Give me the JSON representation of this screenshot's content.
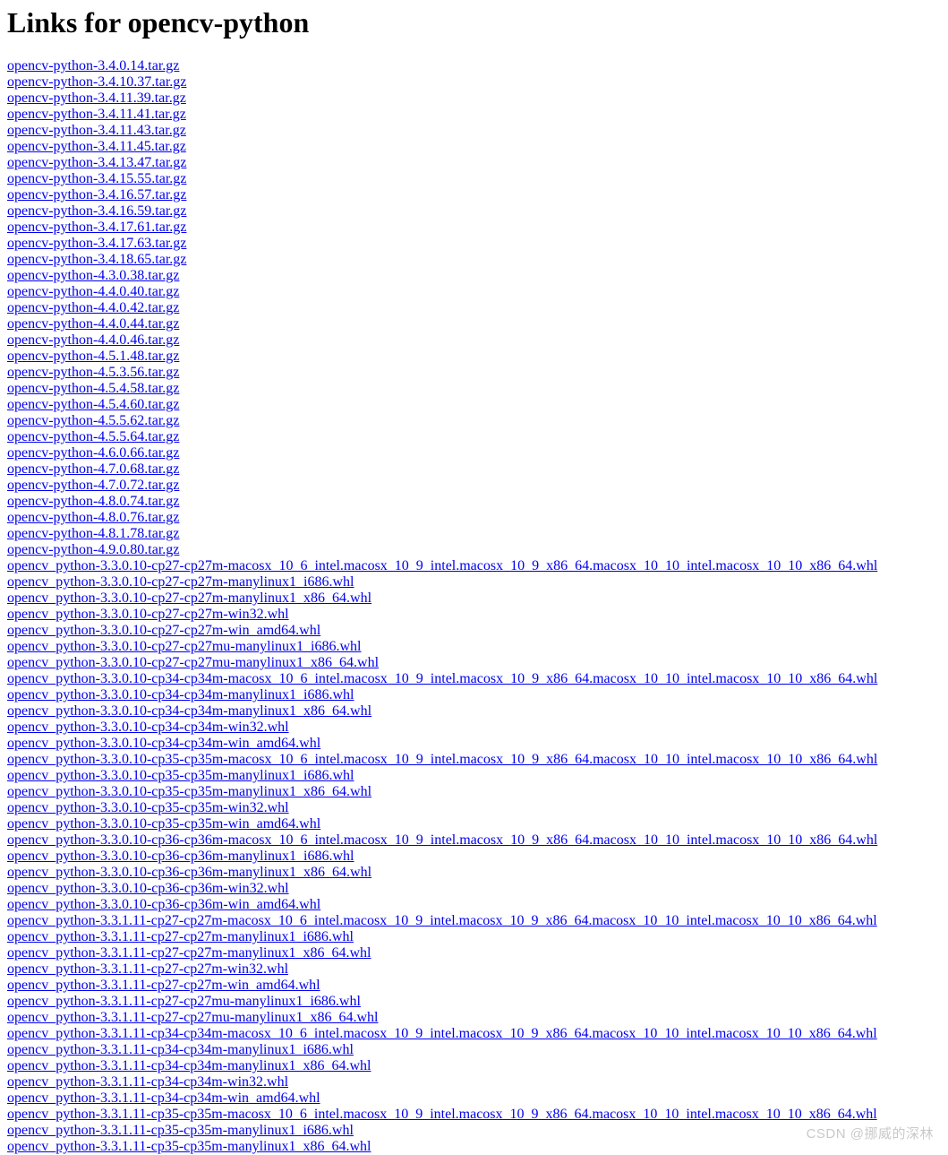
{
  "page": {
    "title": "Links for opencv-python",
    "link_color": "#0000ee",
    "background_color": "#ffffff",
    "text_color": "#000000"
  },
  "watermark": {
    "text": "CSDN @挪威的深林",
    "color": "#c9c9c9"
  },
  "links": [
    {
      "label": "opencv-python-3.4.0.14.tar.gz"
    },
    {
      "label": "opencv-python-3.4.10.37.tar.gz"
    },
    {
      "label": "opencv-python-3.4.11.39.tar.gz"
    },
    {
      "label": "opencv-python-3.4.11.41.tar.gz"
    },
    {
      "label": "opencv-python-3.4.11.43.tar.gz"
    },
    {
      "label": "opencv-python-3.4.11.45.tar.gz"
    },
    {
      "label": "opencv-python-3.4.13.47.tar.gz"
    },
    {
      "label": "opencv-python-3.4.15.55.tar.gz"
    },
    {
      "label": "opencv-python-3.4.16.57.tar.gz"
    },
    {
      "label": "opencv-python-3.4.16.59.tar.gz"
    },
    {
      "label": "opencv-python-3.4.17.61.tar.gz"
    },
    {
      "label": "opencv-python-3.4.17.63.tar.gz"
    },
    {
      "label": "opencv-python-3.4.18.65.tar.gz"
    },
    {
      "label": "opencv-python-4.3.0.38.tar.gz"
    },
    {
      "label": "opencv-python-4.4.0.40.tar.gz"
    },
    {
      "label": "opencv-python-4.4.0.42.tar.gz"
    },
    {
      "label": "opencv-python-4.4.0.44.tar.gz"
    },
    {
      "label": "opencv-python-4.4.0.46.tar.gz"
    },
    {
      "label": "opencv-python-4.5.1.48.tar.gz"
    },
    {
      "label": "opencv-python-4.5.3.56.tar.gz"
    },
    {
      "label": "opencv-python-4.5.4.58.tar.gz"
    },
    {
      "label": "opencv-python-4.5.4.60.tar.gz"
    },
    {
      "label": "opencv-python-4.5.5.62.tar.gz"
    },
    {
      "label": "opencv-python-4.5.5.64.tar.gz"
    },
    {
      "label": "opencv-python-4.6.0.66.tar.gz"
    },
    {
      "label": "opencv-python-4.7.0.68.tar.gz"
    },
    {
      "label": "opencv-python-4.7.0.72.tar.gz"
    },
    {
      "label": "opencv-python-4.8.0.74.tar.gz"
    },
    {
      "label": "opencv-python-4.8.0.76.tar.gz"
    },
    {
      "label": "opencv-python-4.8.1.78.tar.gz"
    },
    {
      "label": "opencv-python-4.9.0.80.tar.gz"
    },
    {
      "label": "opencv_python-3.3.0.10-cp27-cp27m-macosx_10_6_intel.macosx_10_9_intel.macosx_10_9_x86_64.macosx_10_10_intel.macosx_10_10_x86_64.whl"
    },
    {
      "label": "opencv_python-3.3.0.10-cp27-cp27m-manylinux1_i686.whl"
    },
    {
      "label": "opencv_python-3.3.0.10-cp27-cp27m-manylinux1_x86_64.whl"
    },
    {
      "label": "opencv_python-3.3.0.10-cp27-cp27m-win32.whl"
    },
    {
      "label": "opencv_python-3.3.0.10-cp27-cp27m-win_amd64.whl"
    },
    {
      "label": "opencv_python-3.3.0.10-cp27-cp27mu-manylinux1_i686.whl"
    },
    {
      "label": "opencv_python-3.3.0.10-cp27-cp27mu-manylinux1_x86_64.whl"
    },
    {
      "label": "opencv_python-3.3.0.10-cp34-cp34m-macosx_10_6_intel.macosx_10_9_intel.macosx_10_9_x86_64.macosx_10_10_intel.macosx_10_10_x86_64.whl"
    },
    {
      "label": "opencv_python-3.3.0.10-cp34-cp34m-manylinux1_i686.whl"
    },
    {
      "label": "opencv_python-3.3.0.10-cp34-cp34m-manylinux1_x86_64.whl"
    },
    {
      "label": "opencv_python-3.3.0.10-cp34-cp34m-win32.whl"
    },
    {
      "label": "opencv_python-3.3.0.10-cp34-cp34m-win_amd64.whl"
    },
    {
      "label": "opencv_python-3.3.0.10-cp35-cp35m-macosx_10_6_intel.macosx_10_9_intel.macosx_10_9_x86_64.macosx_10_10_intel.macosx_10_10_x86_64.whl"
    },
    {
      "label": "opencv_python-3.3.0.10-cp35-cp35m-manylinux1_i686.whl"
    },
    {
      "label": "opencv_python-3.3.0.10-cp35-cp35m-manylinux1_x86_64.whl"
    },
    {
      "label": "opencv_python-3.3.0.10-cp35-cp35m-win32.whl"
    },
    {
      "label": "opencv_python-3.3.0.10-cp35-cp35m-win_amd64.whl"
    },
    {
      "label": "opencv_python-3.3.0.10-cp36-cp36m-macosx_10_6_intel.macosx_10_9_intel.macosx_10_9_x86_64.macosx_10_10_intel.macosx_10_10_x86_64.whl"
    },
    {
      "label": "opencv_python-3.3.0.10-cp36-cp36m-manylinux1_i686.whl"
    },
    {
      "label": "opencv_python-3.3.0.10-cp36-cp36m-manylinux1_x86_64.whl"
    },
    {
      "label": "opencv_python-3.3.0.10-cp36-cp36m-win32.whl"
    },
    {
      "label": "opencv_python-3.3.0.10-cp36-cp36m-win_amd64.whl"
    },
    {
      "label": "opencv_python-3.3.1.11-cp27-cp27m-macosx_10_6_intel.macosx_10_9_intel.macosx_10_9_x86_64.macosx_10_10_intel.macosx_10_10_x86_64.whl"
    },
    {
      "label": "opencv_python-3.3.1.11-cp27-cp27m-manylinux1_i686.whl"
    },
    {
      "label": "opencv_python-3.3.1.11-cp27-cp27m-manylinux1_x86_64.whl"
    },
    {
      "label": "opencv_python-3.3.1.11-cp27-cp27m-win32.whl"
    },
    {
      "label": "opencv_python-3.3.1.11-cp27-cp27m-win_amd64.whl"
    },
    {
      "label": "opencv_python-3.3.1.11-cp27-cp27mu-manylinux1_i686.whl"
    },
    {
      "label": "opencv_python-3.3.1.11-cp27-cp27mu-manylinux1_x86_64.whl"
    },
    {
      "label": "opencv_python-3.3.1.11-cp34-cp34m-macosx_10_6_intel.macosx_10_9_intel.macosx_10_9_x86_64.macosx_10_10_intel.macosx_10_10_x86_64.whl"
    },
    {
      "label": "opencv_python-3.3.1.11-cp34-cp34m-manylinux1_i686.whl"
    },
    {
      "label": "opencv_python-3.3.1.11-cp34-cp34m-manylinux1_x86_64.whl"
    },
    {
      "label": "opencv_python-3.3.1.11-cp34-cp34m-win32.whl"
    },
    {
      "label": "opencv_python-3.3.1.11-cp34-cp34m-win_amd64.whl"
    },
    {
      "label": "opencv_python-3.3.1.11-cp35-cp35m-macosx_10_6_intel.macosx_10_9_intel.macosx_10_9_x86_64.macosx_10_10_intel.macosx_10_10_x86_64.whl"
    },
    {
      "label": "opencv_python-3.3.1.11-cp35-cp35m-manylinux1_i686.whl"
    },
    {
      "label": "opencv_python-3.3.1.11-cp35-cp35m-manylinux1_x86_64.whl"
    }
  ]
}
